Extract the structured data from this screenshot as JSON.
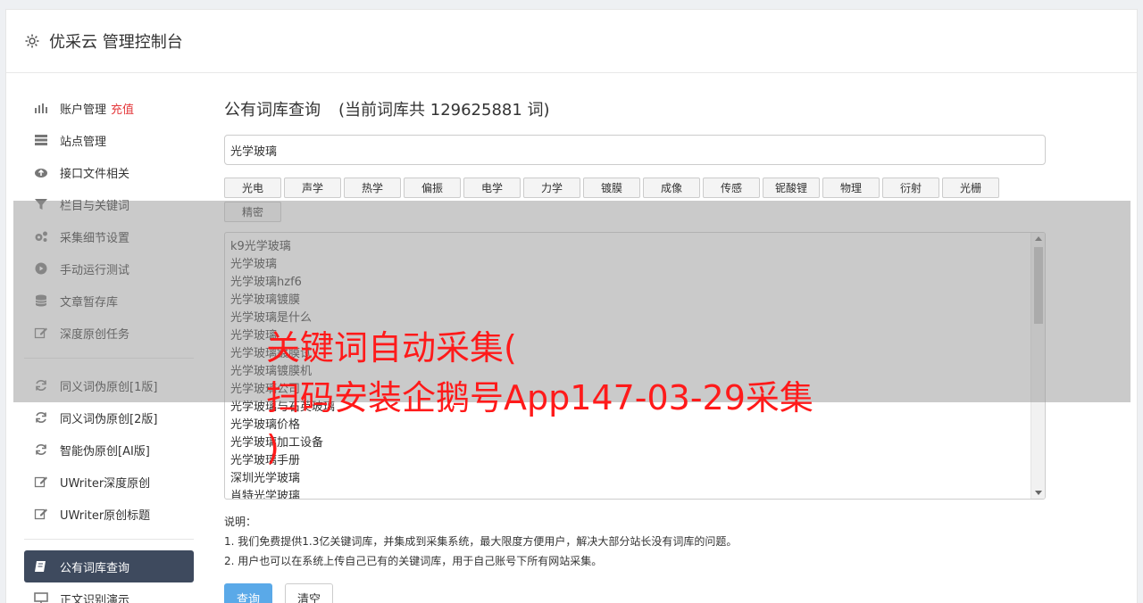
{
  "header": {
    "title": "优采云 管理控制台",
    "icon": "gear-icon"
  },
  "sidebar": {
    "groups": [
      [
        {
          "label": "账户管理",
          "tag": "充值",
          "icon": "bar-chart-icon"
        },
        {
          "label": "站点管理",
          "icon": "server-icon"
        },
        {
          "label": "接口文件相关",
          "icon": "cloud-upload-icon"
        },
        {
          "label": "栏目与关键词",
          "icon": "filter-icon"
        },
        {
          "label": "采集细节设置",
          "icon": "gears-icon"
        },
        {
          "label": "手动运行测试",
          "icon": "play-circle-icon"
        },
        {
          "label": "文章暂存库",
          "icon": "database-icon"
        },
        {
          "label": "深度原创任务",
          "icon": "edit-icon"
        }
      ],
      [
        {
          "label": "同义词伪原创[1版]",
          "icon": "refresh-icon"
        },
        {
          "label": "同义词伪原创[2版]",
          "icon": "refresh-icon"
        },
        {
          "label": "智能伪原创[AI版]",
          "icon": "refresh-icon"
        },
        {
          "label": "UWriter深度原创",
          "icon": "edit-icon"
        },
        {
          "label": "UWriter原创标题",
          "icon": "edit-icon"
        }
      ],
      [
        {
          "label": "公有词库查询",
          "icon": "book-icon",
          "active": true
        },
        {
          "label": "正文识别演示",
          "icon": "monitor-icon"
        }
      ]
    ]
  },
  "main": {
    "heading": "公有词库查询",
    "count_text": "(当前词库共 129625881 词)",
    "search_value": "光学玻璃",
    "tags": [
      "光电",
      "声学",
      "热学",
      "偏振",
      "电学",
      "力学",
      "镀膜",
      "成像",
      "传感",
      "铌酸锂",
      "物理",
      "衍射",
      "光栅",
      "精密"
    ],
    "results": [
      "k9光学玻璃",
      "光学玻璃",
      "光学玻璃hzf6",
      "光学玻璃镀膜",
      "光学玻璃是什么",
      "光学玻璃",
      "光学玻璃镀膜试",
      "光学玻璃镀膜机",
      "光学玻璃公司",
      "光学玻璃与石英玻璃",
      "光学玻璃价格",
      "光学玻璃加工设备",
      "光学玻璃手册",
      "深圳光学玻璃",
      "肖特光学玻璃"
    ],
    "notes_title": "说明：",
    "notes": [
      "1. 我们免费提供1.3亿关键词库，并集成到采集系统，最大限度方便用户，解决大部分站长没有词库的问题。",
      "2. 用户也可以在系统上传自己已有的关键词库，用于自己账号下所有网站采集。"
    ],
    "query_button": "查询",
    "clear_button": "清空"
  },
  "watermark": {
    "line1": "关键词自动采集(",
    "line2": "扫码安装企鹅号App147-03-29采集",
    "line3": ")"
  },
  "colors": {
    "active_nav": "#3e4a5e",
    "primary_button": "#5aa9e8",
    "watermark": "#ff1a1a",
    "accent_red": "#e4393c"
  }
}
